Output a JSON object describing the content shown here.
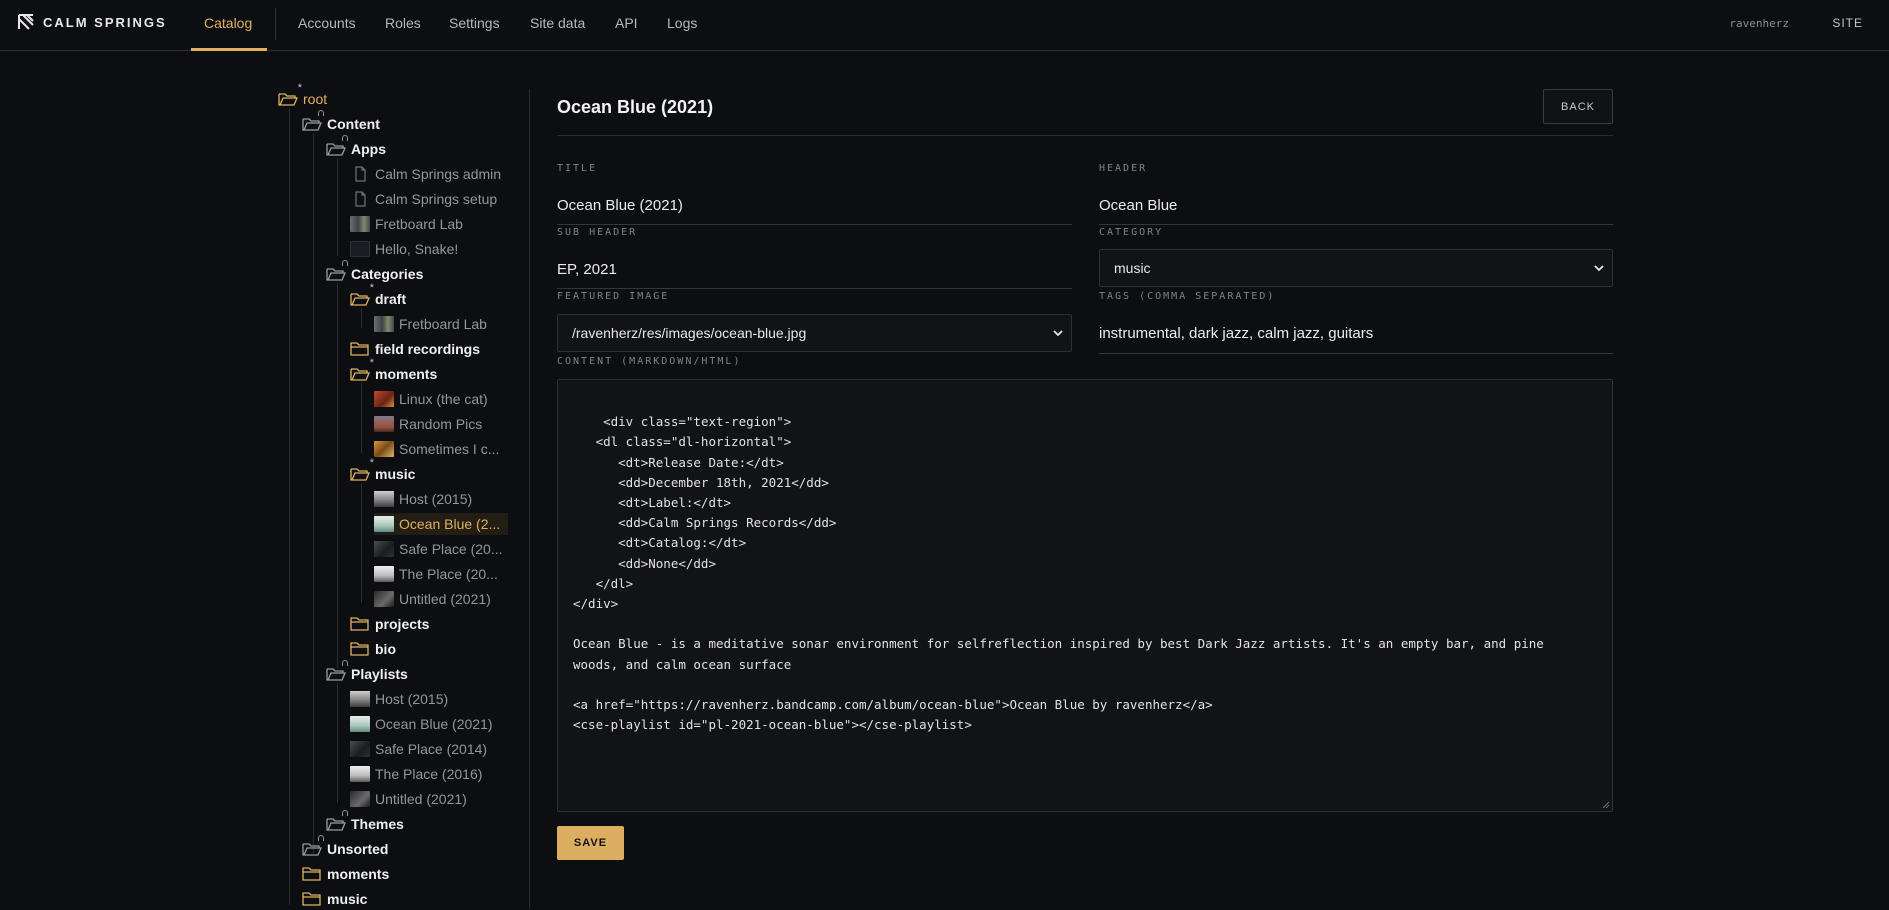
{
  "brand": {
    "name": "CALM SPRINGS"
  },
  "nav": {
    "items": [
      "Catalog",
      "Accounts",
      "Roles",
      "Settings",
      "Site data",
      "API",
      "Logs"
    ],
    "user": "ravenherz",
    "site": "SITE"
  },
  "tree": {
    "root": "root",
    "content": "Content",
    "apps": "Apps",
    "apps_items": [
      "Calm Springs admin",
      "Calm Springs setup",
      "Fretboard Lab",
      "Hello, Snake!"
    ],
    "categories": "Categories",
    "draft": "draft",
    "draft_items": [
      "Fretboard Lab"
    ],
    "field_recordings": "field recordings",
    "moments": "moments",
    "moments_items": [
      "Linux (the cat)",
      "Random Pics",
      "Sometimes I c..."
    ],
    "music": "music",
    "music_items": [
      "Host (2015)",
      "Ocean Blue (2...",
      "Safe Place (20...",
      "The Place (20...",
      "Untitled (2021)"
    ],
    "projects": "projects",
    "bio": "bio",
    "playlists": "Playlists",
    "playlists_items": [
      "Host (2015)",
      "Ocean Blue (2021)",
      "Safe Place (2014)",
      "The Place (2016)",
      "Untitled (2021)"
    ],
    "themes": "Themes",
    "unsorted": "Unsorted",
    "root_moments": "moments",
    "root_music": "music"
  },
  "editor": {
    "page_title": "Ocean Blue (2021)",
    "back_label": "BACK",
    "title_label": "TITLE",
    "title_value": "Ocean Blue (2021)",
    "header_label": "HEADER",
    "header_value": "Ocean Blue",
    "subheader_label": "SUB HEADER",
    "subheader_value": "EP, 2021",
    "category_label": "CATEGORY",
    "category_value": "music",
    "featured_label": "FEATURED IMAGE",
    "featured_value": "/ravenherz/res/images/ocean-blue.jpg",
    "tags_label": "TAGS (COMMA SEPARATED)",
    "tags_value": "instrumental, dark jazz, calm jazz, guitars",
    "content_label": "CONTENT (MARKDOWN/HTML)",
    "content_value": "<div class=\"text-region\">\n   <dl class=\"dl-horizontal\">\n      <dt>Release Date:</dt>\n      <dd>December 18th, 2021</dd>\n      <dt>Label:</dt>\n      <dd>Calm Springs Records</dd>\n      <dt>Catalog:</dt>\n      <dd>None</dd>\n   </dl>\n</div>\n\nOcean Blue - is a meditative sonar environment for selfreflection inspired by best Dark Jazz artists. It's an empty bar, and pine\nwoods, and calm ocean surface\n\n<a href=\"https://ravenherz.bandcamp.com/album/ocean-blue\">Ocean Blue by ravenherz</a>\n<cse-playlist id=\"pl-2021-ocean-blue\"></cse-playlist>",
    "save_label": "SAVE"
  },
  "colors": {
    "accent": "#e0b15f",
    "background": "#0d0e11",
    "panel": "#121317"
  }
}
